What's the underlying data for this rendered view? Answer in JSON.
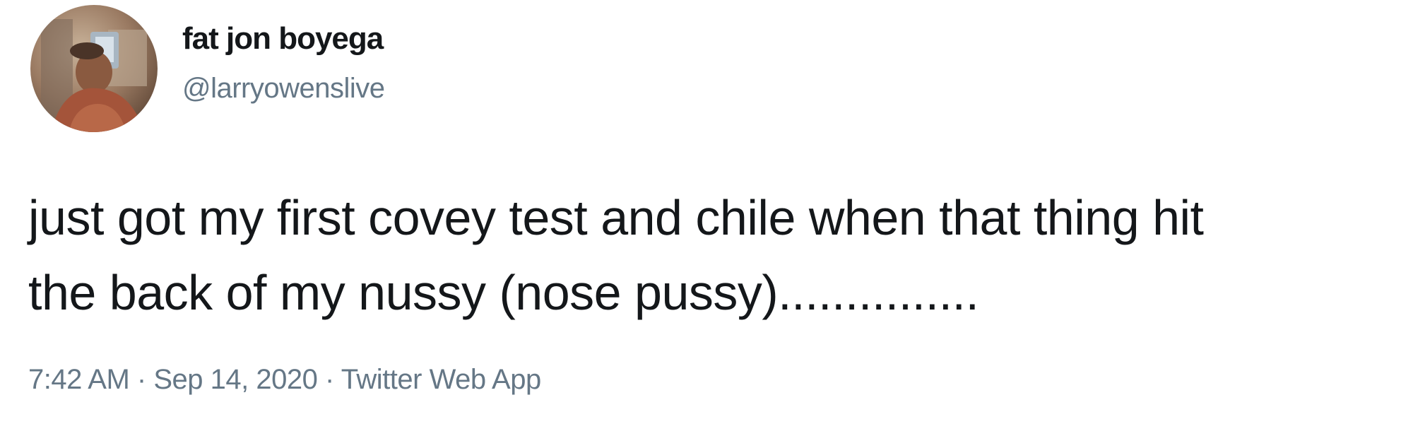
{
  "tweet": {
    "author": {
      "display_name": "fat jon boyega",
      "handle": "@larryowenslive",
      "avatar_icon": "user-avatar-photo"
    },
    "text_lines": [
      "just got my first covey test and chile when that thing hit",
      "the back of my nussy (nose pussy)..............."
    ],
    "meta": {
      "time": "7:42 AM",
      "separator": "·",
      "date": "Sep 14, 2020",
      "source": "Twitter Web App"
    }
  },
  "colors": {
    "text_primary": "#14171a",
    "text_secondary": "#657786",
    "background": "#ffffff"
  }
}
